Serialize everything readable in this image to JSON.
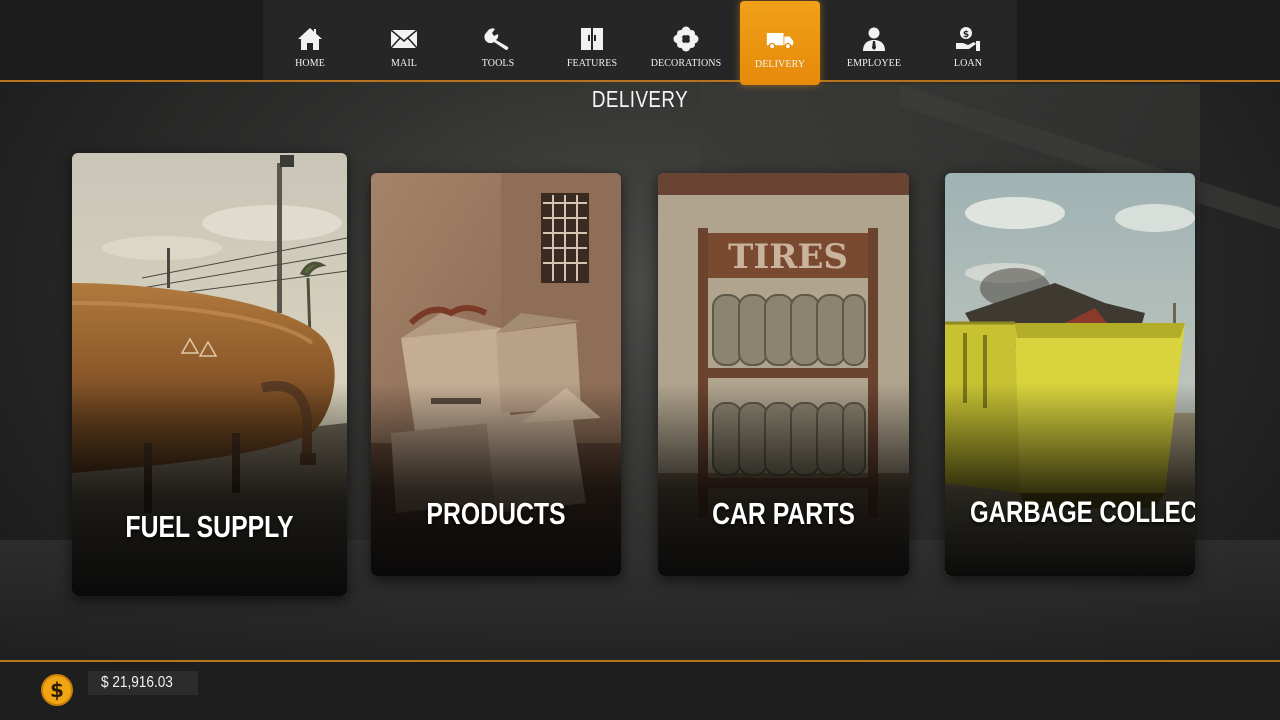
{
  "nav": {
    "items": [
      {
        "label": "HOME",
        "icon": "home-icon"
      },
      {
        "label": "MAIL",
        "icon": "mail-icon"
      },
      {
        "label": "TOOLS",
        "icon": "wrench-icon"
      },
      {
        "label": "FEATURES",
        "icon": "features-icon"
      },
      {
        "label": "DECORATIONS",
        "icon": "flower-icon"
      },
      {
        "label": "DELIVERY",
        "icon": "truck-icon",
        "active": true
      },
      {
        "label": "EMPLOYEE",
        "icon": "employee-icon"
      },
      {
        "label": "LOAN",
        "icon": "loan-icon"
      }
    ]
  },
  "page": {
    "title": "DELIVERY"
  },
  "cards": {
    "fuel": {
      "label": "FUEL SUPPLY"
    },
    "products": {
      "label": "PRODUCTS"
    },
    "parts": {
      "label": "CAR PARTS"
    },
    "garbage": {
      "label": "GARBAGE COLLECTION"
    }
  },
  "wallet": {
    "balance": "$ 21,916.03",
    "currency_symbol": "$"
  },
  "colors": {
    "accent": "#e68a0a",
    "bar_border": "#b8731e",
    "coin": "#f2a514"
  }
}
